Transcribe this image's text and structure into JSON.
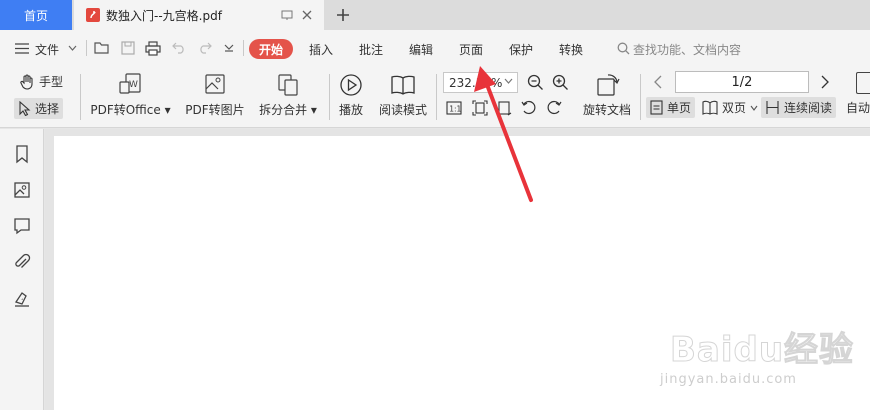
{
  "titlebar": {
    "home_tab": "首页",
    "doc_tab": "数独入门--九宫格.pdf",
    "new_tab_symbol": "+"
  },
  "menubar": {
    "file_label": "文件",
    "start_label": "开始",
    "items": [
      "插入",
      "批注",
      "编辑",
      "页面",
      "保护",
      "转换"
    ],
    "search_placeholder": "查找功能、文档内容"
  },
  "ribbon": {
    "hand_label": "手型",
    "select_label": "选择",
    "pdf_to_office": "PDF转Office",
    "pdf_to_image": "PDF转图片",
    "split_merge": "拆分合并",
    "play": "播放",
    "read_mode": "阅读模式",
    "zoom_value": "232.34%",
    "rotate_doc": "旋转文档",
    "page_value": "1/2",
    "single_page": "单页",
    "double_page": "双页",
    "continuous_read": "连续阅读",
    "auto": "自动"
  },
  "watermark": {
    "main": "Baidu经验",
    "sub": "jingyan.baidu.com"
  },
  "colors": {
    "accent_blue": "#3f7ef3",
    "start_red": "#e4534a",
    "arrow_red": "#e8333a"
  }
}
